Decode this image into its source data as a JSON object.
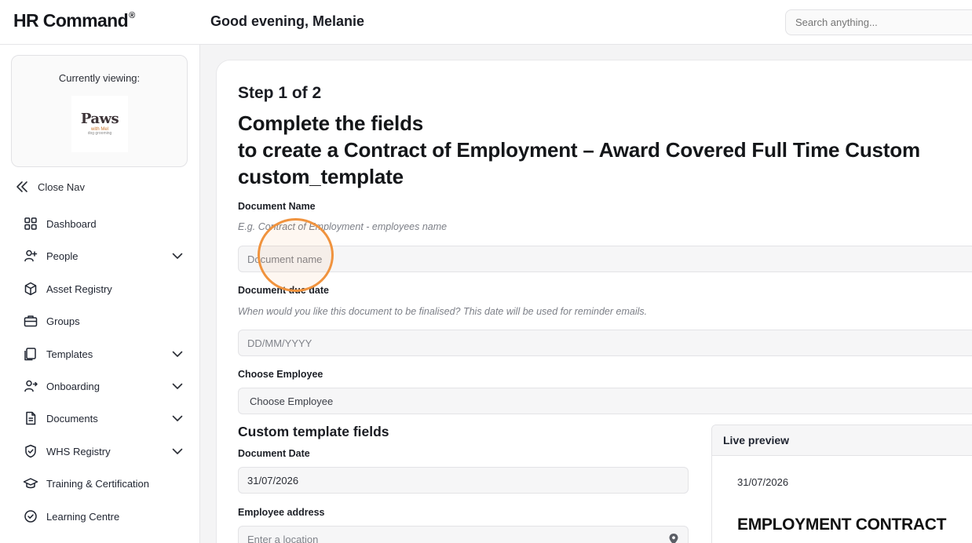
{
  "app": {
    "logo": "HR Command",
    "logo_mark": "®"
  },
  "header": {
    "greeting": "Good evening, Melanie",
    "search_placeholder": "Search anything..."
  },
  "sidebar": {
    "viewing_label": "Currently viewing:",
    "org_logo": {
      "brand": "Paws",
      "sub": "with Mel",
      "sub2": "dog grooming"
    },
    "close_nav": "Close Nav",
    "items": [
      {
        "label": "Dashboard",
        "icon": "grid-icon",
        "expandable": false
      },
      {
        "label": "People",
        "icon": "user-plus-icon",
        "expandable": true
      },
      {
        "label": "Asset Registry",
        "icon": "box-icon",
        "expandable": false
      },
      {
        "label": "Groups",
        "icon": "briefcase-icon",
        "expandable": false
      },
      {
        "label": "Templates",
        "icon": "copy-icon",
        "expandable": true
      },
      {
        "label": "Onboarding",
        "icon": "user-arrow-icon",
        "expandable": true
      },
      {
        "label": "Documents",
        "icon": "file-icon",
        "expandable": true
      },
      {
        "label": "WHS Registry",
        "icon": "shield-check-icon",
        "expandable": true
      },
      {
        "label": "Training & Certification",
        "icon": "graduation-cap-icon",
        "expandable": false
      },
      {
        "label": "Learning Centre",
        "icon": "check-circle-icon",
        "expandable": false
      }
    ]
  },
  "form": {
    "step": "Step 1 of 2",
    "title_line1": "Complete the fields",
    "title_line2": "to create a Contract of Employment – Award Covered Full Time Custom",
    "title_line3": "custom_template",
    "document_name": {
      "label": "Document Name",
      "hint": "E.g. Contract of Employment - employees name",
      "placeholder": "Document name"
    },
    "due_date": {
      "label": "Document due date",
      "hint": "When would you like this document to be finalised? This date will be used for reminder emails.",
      "placeholder": "DD/MM/YYYY"
    },
    "employee": {
      "label": "Choose Employee",
      "value": "Choose Employee"
    },
    "custom_section_title": "Custom template fields",
    "document_date": {
      "label": "Document Date",
      "value": "31/07/2026"
    },
    "employee_address": {
      "label": "Employee address",
      "placeholder": "Enter a location"
    }
  },
  "preview": {
    "heading": "Live preview",
    "date": "31/07/2026",
    "doc_title": "EMPLOYMENT CONTRACT"
  },
  "colors": {
    "highlight": "#f0933e",
    "text": "#1f2430"
  }
}
